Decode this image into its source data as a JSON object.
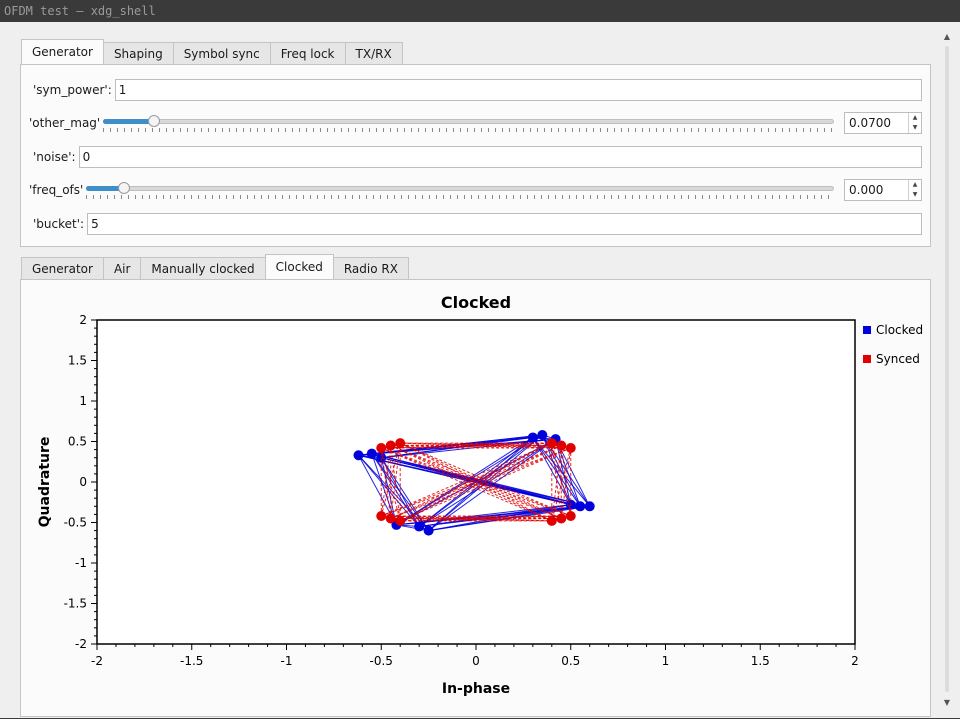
{
  "window": {
    "title": "OFDM test — xdg_shell"
  },
  "top_tabs": [
    "Generator",
    "Shaping",
    "Symbol sync",
    "Freq lock",
    "TX/RX"
  ],
  "top_tab_active": 0,
  "params": {
    "sym_power": {
      "label": "'sym_power':",
      "value": "1"
    },
    "other_mag": {
      "label": "'other_mag'",
      "value": "0.0700",
      "fraction": 0.07
    },
    "noise": {
      "label": "'noise':",
      "value": "0"
    },
    "freq_ofs": {
      "label": "'freq_ofs'",
      "value": "0.000",
      "fraction": 0.05
    },
    "bucket": {
      "label": "'bucket':",
      "value": "5"
    }
  },
  "bottom_tabs": [
    "Generator",
    "Air",
    "Manually clocked",
    "Clocked",
    "Radio RX"
  ],
  "bottom_tab_active": 3,
  "colors": {
    "clocked": "#0000dd",
    "synced": "#e00000",
    "accent": "#3d8ec9"
  },
  "icons": {
    "spin_up": "▲",
    "spin_down": "▼",
    "scroll_up": "▲",
    "scroll_down": "▼"
  },
  "chart_data": {
    "type": "line",
    "title": "Clocked",
    "xlabel": "In-phase",
    "ylabel": "Quadrature",
    "xlim": [
      -2,
      2
    ],
    "ylim": [
      -2,
      2
    ],
    "xticks": [
      "-2",
      "-1.5",
      "-1",
      "-0.5",
      "0",
      "0.5",
      "1",
      "1.5",
      "2"
    ],
    "yticks": [
      "2",
      "1.5",
      "1",
      "0.5",
      "0",
      "-0.5",
      "-1",
      "-1.5",
      "-2"
    ],
    "grid": false,
    "legend": "top-right",
    "series": [
      {
        "name": "Clocked",
        "style": "solid-markers",
        "points": [
          [
            0.3,
            0.55
          ],
          [
            -0.55,
            0.35
          ],
          [
            0.55,
            -0.3
          ],
          [
            -0.3,
            -0.55
          ],
          [
            0.42,
            0.53
          ],
          [
            -0.62,
            0.33
          ],
          [
            0.6,
            -0.3
          ],
          [
            -0.42,
            -0.53
          ],
          [
            0.35,
            0.58
          ],
          [
            -0.5,
            0.3
          ],
          [
            0.5,
            -0.28
          ],
          [
            -0.25,
            -0.6
          ]
        ]
      },
      {
        "name": "Synced",
        "style": "dashed-markers",
        "points": [
          [
            -0.45,
            0.45
          ],
          [
            0.45,
            0.45
          ],
          [
            0.45,
            -0.45
          ],
          [
            -0.45,
            -0.45
          ],
          [
            -0.5,
            0.42
          ],
          [
            0.5,
            0.42
          ],
          [
            0.5,
            -0.42
          ],
          [
            -0.5,
            -0.42
          ],
          [
            -0.4,
            0.48
          ],
          [
            0.4,
            0.48
          ],
          [
            0.4,
            -0.48
          ],
          [
            -0.4,
            -0.48
          ]
        ]
      }
    ]
  }
}
